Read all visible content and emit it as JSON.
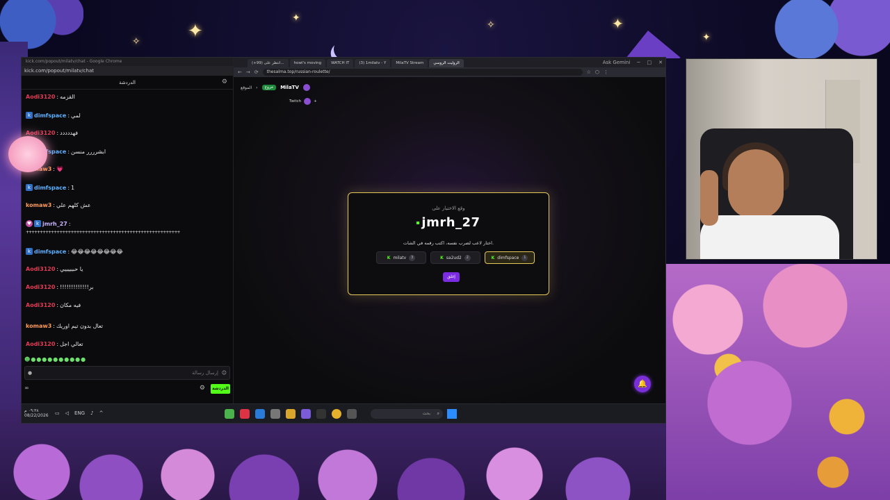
{
  "chat": {
    "window_title": "kick.com/popout/milatv/chat - Google Chrome",
    "url": "kick.com/popout/milatv/chat",
    "header": "الدردشة",
    "messages": [
      {
        "user": "Aodi3120",
        "color": "red",
        "text": "القزمه",
        "badge": ""
      },
      {
        "user": "dimfspace",
        "color": "blue",
        "text": "لمي",
        "badge": "k"
      },
      {
        "user": "Aodi3120",
        "color": "red",
        "text": "فهددددد",
        "badge": ""
      },
      {
        "user": "dimfspace",
        "color": "blue",
        "text": "ابشرررر منسن",
        "badge": "k"
      },
      {
        "user": "komaw3",
        "color": "orange",
        "text": "💗",
        "badge": ""
      },
      {
        "user": "dimfspace",
        "color": "blue",
        "text": "1",
        "badge": "k"
      },
      {
        "user": "komaw3",
        "color": "orange",
        "text": "عش كلهم علي",
        "badge": ""
      },
      {
        "user": "jmrh_27",
        "color": "lav",
        "text": "",
        "badge": "k"
      },
      {
        "user": "",
        "color": "",
        "text": "+++++++++++++++++++++++++++++++++++++++++++++++++++++++",
        "badge": ""
      },
      {
        "user": "dimfspace",
        "color": "blue",
        "text": "😂😂😂😂😂😂😂😂",
        "badge": "k"
      },
      {
        "user": "Aodi3120",
        "color": "red",
        "text": "يا حبيييييي",
        "badge": ""
      },
      {
        "user": "Aodi3120",
        "color": "red",
        "text": "!!!!!!!!!!!!!بر",
        "badge": ""
      },
      {
        "user": "Aodi3120",
        "color": "red",
        "text": "فيه مكان",
        "badge": ""
      },
      {
        "user": "komaw3",
        "color": "orange",
        "text": "تعال بدون تيم اوريك",
        "badge": ""
      },
      {
        "user": "Aodi3120",
        "color": "red",
        "text": "تعالي اجل",
        "badge": ""
      }
    ],
    "input_placeholder": "إرسال رسالة",
    "send_label": "الدردشة",
    "inf_label": "∞"
  },
  "browser": {
    "tabs": [
      {
        "label": "(+99) انتظر على...",
        "active": false
      },
      {
        "label": "howl's moving",
        "active": false
      },
      {
        "label": "WATCH IT",
        "active": false
      },
      {
        "label": "(3) 1milatv - Y",
        "active": false
      },
      {
        "label": "MilaTV Stream",
        "active": false
      },
      {
        "label": "الروليت الروسي",
        "active": true
      }
    ],
    "gemini_label": "Ask Gemini",
    "url": "thesalma.top/russian-roulette/",
    "site": {
      "nav_back": "الموقع",
      "exit_label": "خروج",
      "logo": "MilaTV",
      "twitch_label": "Twitch"
    },
    "modal": {
      "subtitle": "وقع الاختيار على",
      "chosen_name": "jmrh_27",
      "instruction": "اختار لاعب لضرب نفسه، اكتب رقمه في الشات.",
      "options": [
        {
          "name": "milatv",
          "num": "3",
          "selected": false
        },
        {
          "name": "sa2ud2",
          "num": "2",
          "selected": false
        },
        {
          "name": "dimfspace",
          "num": "1",
          "selected": true
        }
      ],
      "close_label": "إغلق"
    }
  },
  "taskbar": {
    "time": "٠٩:٣٨ م",
    "date": "08/22/2026",
    "lang": "ENG",
    "search_placeholder": "بحث"
  },
  "colors": {
    "kick_green": "#53fc18",
    "modal_border": "#e5c85a",
    "accent_purple": "#7b2be2"
  }
}
